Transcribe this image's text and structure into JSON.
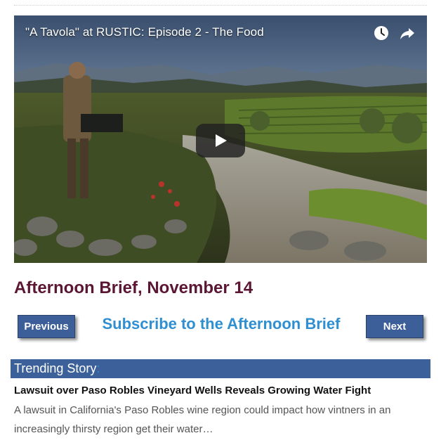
{
  "video": {
    "title": "\"A Tavola\" at RUSTIC: Episode 2 - The Food",
    "icons": [
      "watch-later-icon",
      "share-icon",
      "play-icon"
    ]
  },
  "brief": {
    "title": "Afternoon Brief, November 14"
  },
  "nav": {
    "previous_label": "Previous",
    "subscribe_label": "Subscribe to the Afternoon Brief",
    "next_label": "Next"
  },
  "trending": {
    "label": "Trending Story",
    "colon": ":",
    "headline": "Lawsuit over Paso Robles Vineyard Wells Reveals Growing Water Fight",
    "snippet": "A lawsuit in California's Paso Robles wine region could impact how vintners in an increasingly thirsty region get their water…"
  },
  "colors": {
    "title": "#5a1632",
    "button": "#3d5f99",
    "link": "#2f8fd1",
    "bar": "#3c619a"
  }
}
